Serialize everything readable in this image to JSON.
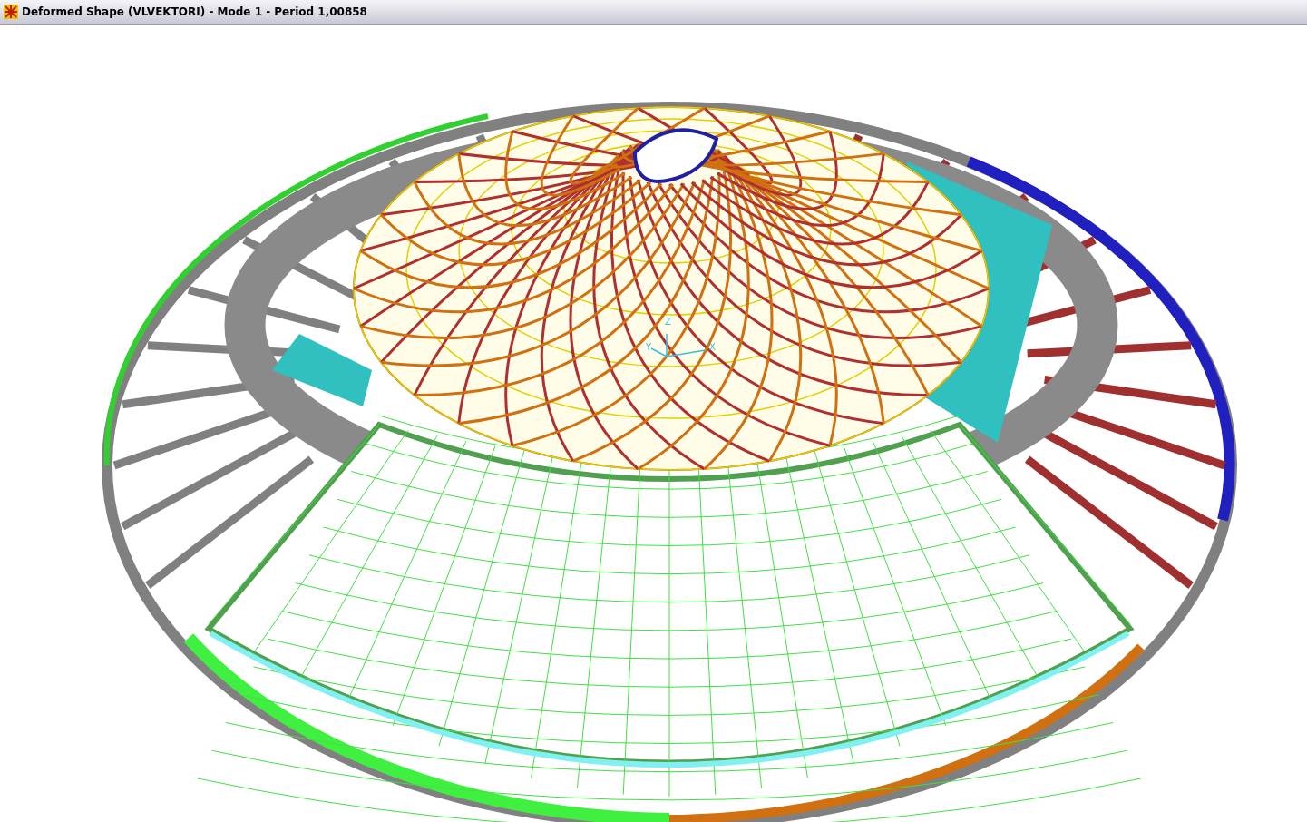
{
  "window": {
    "title": "Deformed Shape (VLVEKTORI) - Mode 1 - Period 1,00858"
  },
  "viewport": {
    "axes": [
      {
        "label": "X"
      },
      {
        "label": "Y"
      },
      {
        "label": "Z"
      }
    ]
  }
}
